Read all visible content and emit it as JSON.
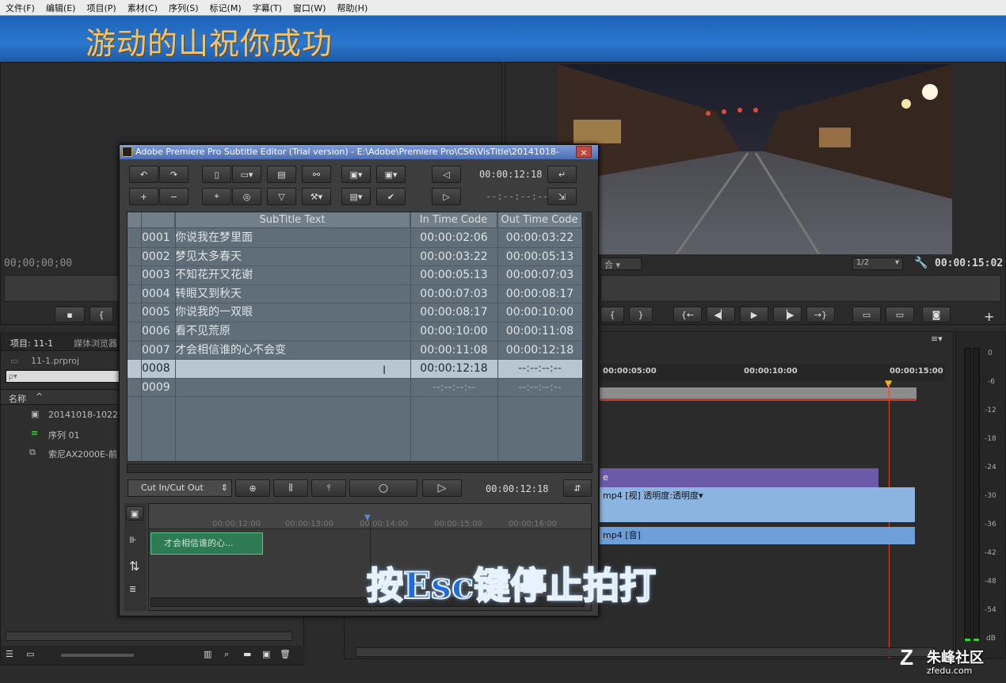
{
  "menu": [
    "文件(F)",
    "编辑(E)",
    "项目(P)",
    "素材(C)",
    "序列(S)",
    "标记(M)",
    "字幕(T)",
    "窗口(W)",
    "帮助(H)"
  ],
  "banner_title": "游动的山祝你成功",
  "source_monitor": {
    "timecode": "00;00;00;00"
  },
  "program_monitor": {
    "zoom": "1/2",
    "timecode": "00:00:15:02",
    "fit_label": "合"
  },
  "project_panel": {
    "tab_project": "项目: 11-1",
    "tab_media": "媒体浏览器",
    "filename": "11-1.prproj",
    "search_placeholder": "ρ▾",
    "name_header": "名称",
    "items": [
      "20141018-102237",
      "序列 01",
      "索尼AX2000E-前"
    ]
  },
  "dialog": {
    "title": "Adobe Premiere Pro Subtitle Editor (Trial version) - E:\\Adobe\\Premiere Pro\\CS6\\VisTitle\\20141018-",
    "close": "×",
    "current_tc": "00:00:12:18",
    "blank_tc": "--:--:--:--",
    "headers": {
      "text": "SubTitle Text",
      "in": "In Time Code",
      "out": "Out Time Code"
    },
    "rows": [
      {
        "num": "0001",
        "text": "你说我在梦里面",
        "in": "00:00:02:06",
        "out": "00:00:03:22"
      },
      {
        "num": "0002",
        "text": "梦见太多春天",
        "in": "00:00:03:22",
        "out": "00:00:05:13"
      },
      {
        "num": "0003",
        "text": "不知花开又花谢",
        "in": "00:00:05:13",
        "out": "00:00:07:03"
      },
      {
        "num": "0004",
        "text": "转眼又到秋天",
        "in": "00:00:07:03",
        "out": "00:00:08:17"
      },
      {
        "num": "0005",
        "text": "你说我的一双眼",
        "in": "00:00:08:17",
        "out": "00:00:10:00"
      },
      {
        "num": "0006",
        "text": "看不见荒原",
        "in": "00:00:10:00",
        "out": "00:00:11:08"
      },
      {
        "num": "0007",
        "text": "才会相信谁的心不会变",
        "in": "00:00:11:08",
        "out": "00:00:12:18"
      },
      {
        "num": "0008",
        "text": "",
        "in": "00:00:12:18",
        "out": "--:--:--:--"
      },
      {
        "num": "0009",
        "text": "",
        "in": "--:--:--:--",
        "out": "--:--:--:--"
      }
    ],
    "mode_select": "Cut In/Cut Out",
    "bottom_tc": "00:00:12:18",
    "ruler": [
      "00:00:12:00",
      "00:00:13:00",
      "00:00:14:00",
      "00:00:15:00",
      "00:00:16:00"
    ],
    "clip_label": "才会相信谁的心..."
  },
  "timeline": {
    "ruler": [
      "00:00:05:00",
      "00:00:10:00",
      "00:00:15:00"
    ],
    "video_clip": "mp4 [视] 透明度:透明度▾",
    "audio_clip": "mp4 [音]",
    "purple_clip": "e"
  },
  "meter": {
    "labels": [
      "0",
      "-6",
      "-12",
      "-18",
      "-24",
      "-30",
      "-36",
      "-42",
      "-48",
      "-54",
      "dB"
    ]
  },
  "overlay_text": "按Esc键停止拍打",
  "watermark": {
    "brand": "朱峰社区",
    "url": "zfedu.com"
  }
}
